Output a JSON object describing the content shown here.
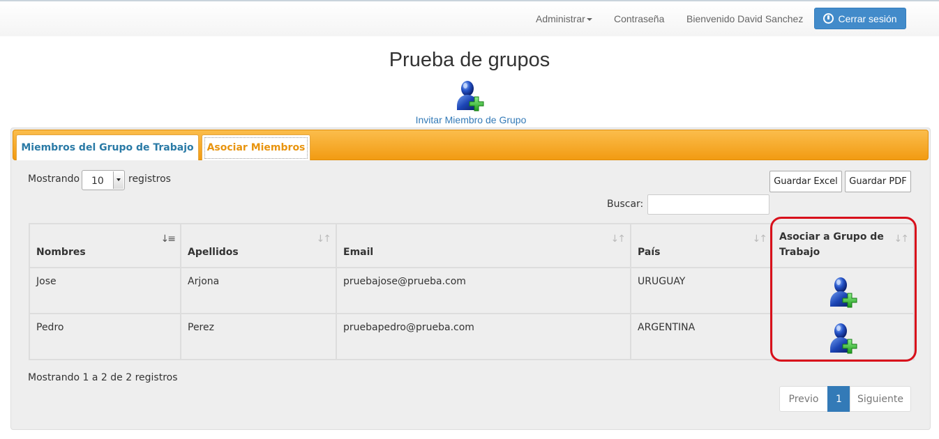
{
  "navbar": {
    "admin_label": "Administrar",
    "password_label": "Contraseña",
    "welcome_text": "Bienvenido David Sanchez",
    "logout_label": "Cerrar sesión"
  },
  "page": {
    "title": "Prueba de grupos",
    "invite_label": "Invitar Miembro de Grupo"
  },
  "tabs": [
    {
      "label": "Miembros del Grupo de Trabajo",
      "active": false
    },
    {
      "label": "Asociar Miembros",
      "active": true
    }
  ],
  "controls": {
    "show_label": "Mostrando",
    "page_size": "10",
    "records_label": "registros",
    "excel_label": "Guardar Excel",
    "pdf_label": "Guardar PDF",
    "search_label": "Buscar:",
    "search_value": ""
  },
  "table": {
    "columns": [
      "Nombres",
      "Apellidos",
      "Email",
      "País",
      "Asociar a Grupo de Trabajo"
    ],
    "rows": [
      {
        "nombres": "Jose",
        "apellidos": "Arjona",
        "email": "pruebajose@prueba.com",
        "pais": "URUGUAY"
      },
      {
        "nombres": "Pedro",
        "apellidos": "Perez",
        "email": "pruebapedro@prueba.com",
        "pais": "ARGENTINA"
      }
    ]
  },
  "footer": {
    "info": "Mostrando 1 a 2 de 2 registros",
    "prev_label": "Previo",
    "current_page": "1",
    "next_label": "Siguiente"
  },
  "colors": {
    "accent": "#428bca",
    "tab_bar": "#f29b12",
    "highlight": "#d8101b"
  }
}
